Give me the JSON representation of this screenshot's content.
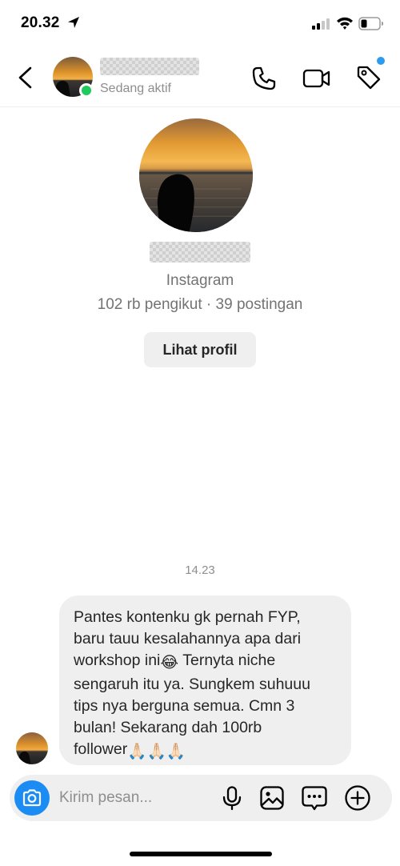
{
  "status_bar": {
    "time": "20.32",
    "icons": [
      "location-arrow-icon",
      "signal-icon",
      "wifi-icon",
      "battery-icon"
    ]
  },
  "header": {
    "icons": [
      "back-icon",
      "call-icon",
      "video-call-icon",
      "tag-icon"
    ],
    "active_status": "Sedang aktif",
    "active_color": "#1fc95c",
    "notification_dot_color": "#2d9bf0"
  },
  "profile": {
    "source": "Instagram",
    "stats": "102 rb pengikut · 39 postingan",
    "view_profile_label": "Lihat profil"
  },
  "conversation": {
    "timestamp": "14.23",
    "message": {
      "line1": "Pantes kontenku gk pernah FYP,",
      "line2": "baru tauu kesalahannya apa dari",
      "line3a": "workshop ini",
      "emoji_laugh": "😂",
      "line3b": " Ternyta niche",
      "line4": "sengaruh itu ya. Sungkem suhuuu",
      "line5": "tips nya berguna semua. Cmn 3",
      "line6": "bulan! Sekarang dah 100rb",
      "line7": "follower",
      "emoji_pray": "🙏🏻🙏🏻🙏🏻"
    }
  },
  "composer": {
    "placeholder": "Kirim pesan...",
    "icons": [
      "camera-icon",
      "microphone-icon",
      "gallery-icon",
      "sticker-icon",
      "plus-icon"
    ],
    "accent_color": "#1a8cf4"
  }
}
